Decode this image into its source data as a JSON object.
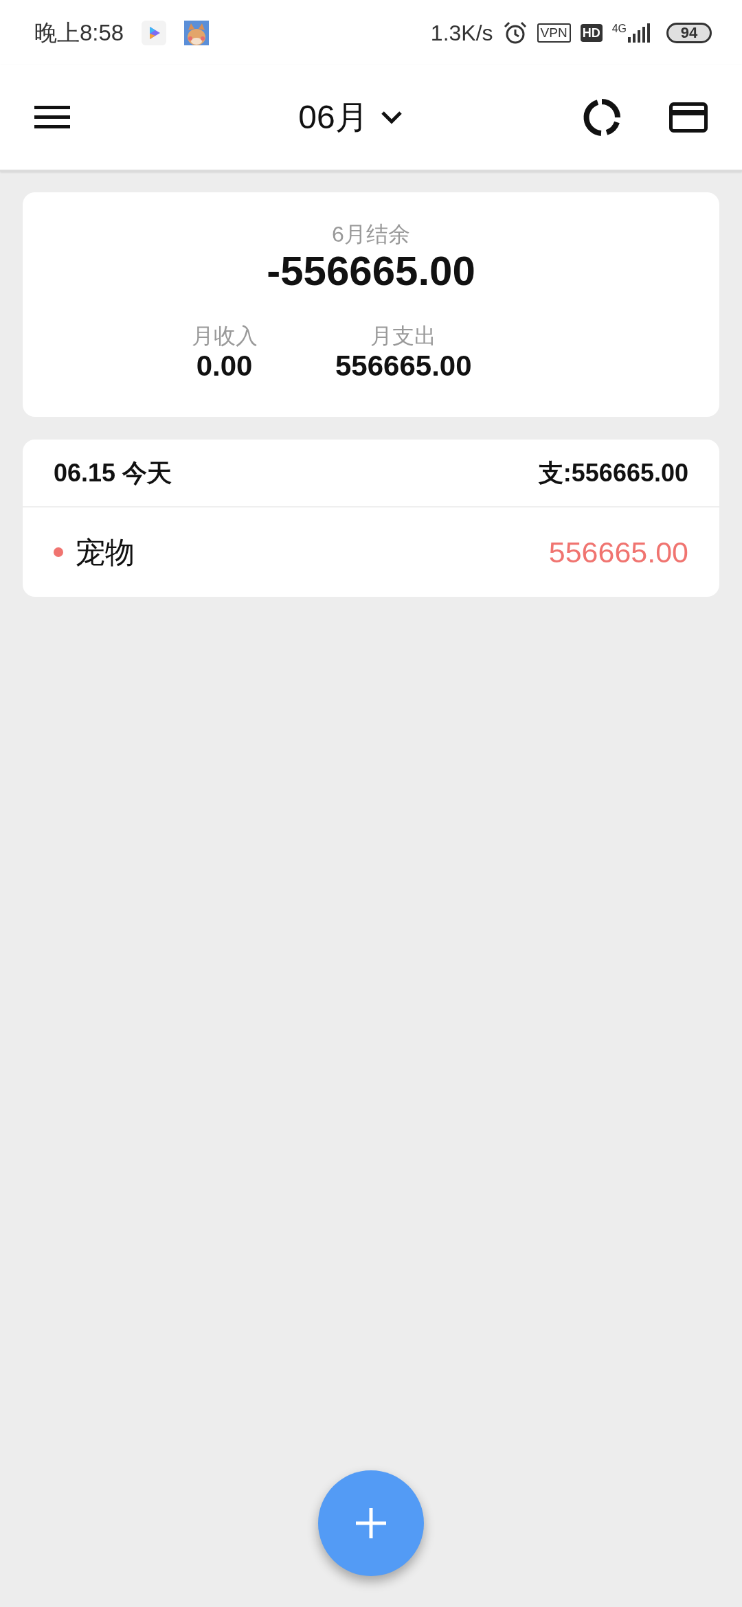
{
  "status_bar": {
    "time": "晚上8:58",
    "net_speed": "1.3K/s",
    "vpn": "VPN",
    "hd": "HD",
    "network": "4G",
    "battery": "94"
  },
  "header": {
    "month": "06月"
  },
  "summary": {
    "title": "6月结余",
    "balance": "-556665.00",
    "income_label": "月收入",
    "income": "0.00",
    "expense_label": "月支出",
    "expense": "556665.00"
  },
  "days": [
    {
      "date": "06.15 今天",
      "total": "支:556665.00",
      "entries": [
        {
          "category": "宠物",
          "amount": "556665.00",
          "color": "#f07470"
        }
      ]
    }
  ]
}
